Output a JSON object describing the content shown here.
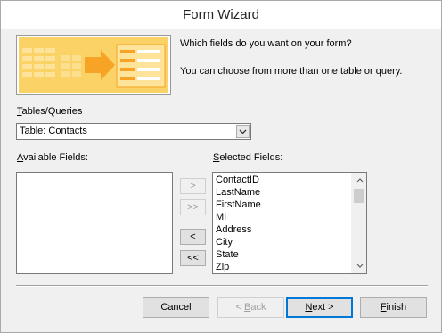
{
  "window": {
    "title": "Form Wizard"
  },
  "prompt": {
    "question": "Which fields do you want on your form?",
    "hint": "You can choose from more than one table or query."
  },
  "tables_queries": {
    "label_underlined": "T",
    "label_rest": "ables/Queries",
    "selected_value": "Table: Contacts"
  },
  "available_fields": {
    "label_underlined": "A",
    "label_rest": "vailable Fields:",
    "items": []
  },
  "selected_fields": {
    "label_underlined": "S",
    "label_rest": "elected Fields:",
    "items": [
      "ContactID",
      "LastName",
      "FirstName",
      "MI",
      "Address",
      "City",
      "State",
      "Zip"
    ]
  },
  "move_buttons": {
    "add_one": ">",
    "add_all": ">>",
    "remove_one": "<",
    "remove_all": "<<"
  },
  "footer": {
    "cancel": "Cancel",
    "back_underlined": "B",
    "back_prefix": "< ",
    "back_rest": "ack",
    "next_underlined": "N",
    "next_rest": "ext >",
    "finish_underlined": "F",
    "finish_rest": "inish"
  },
  "icons": {
    "dropdown": "chevron-down-icon",
    "scroll_up": "scroll-up-arrow-icon",
    "scroll_down": "scroll-down-arrow-icon",
    "wizard": "form-wizard-illustration-icon"
  },
  "colors": {
    "illustration_bg": "#fbd265",
    "illustration_accent": "#f7a325",
    "default_button_border": "#0078d7"
  }
}
